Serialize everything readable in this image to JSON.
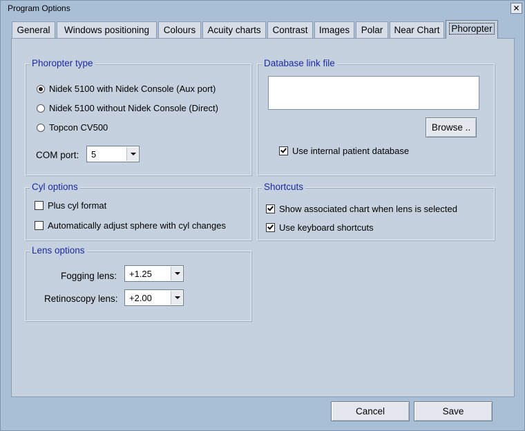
{
  "window": {
    "title": "Program Options",
    "close_glyph": "✕"
  },
  "tabs": [
    {
      "label": "General"
    },
    {
      "label": "Windows positioning"
    },
    {
      "label": "Colours"
    },
    {
      "label": "Acuity charts"
    },
    {
      "label": "Contrast"
    },
    {
      "label": "Images"
    },
    {
      "label": "Polar"
    },
    {
      "label": "Near Chart"
    },
    {
      "label": "Phoropter"
    }
  ],
  "active_tab": "Phoropter",
  "phoropter_type": {
    "title": "Phoropter type",
    "options": [
      {
        "label": "Nidek 5100 with Nidek Console  (Aux port)",
        "selected": true
      },
      {
        "label": "Nidek 5100 without  Nidek Console  (Direct)",
        "selected": false
      },
      {
        "label": "Topcon CV500",
        "selected": false
      }
    ],
    "com_port_label": "COM port:",
    "com_port_value": "5"
  },
  "database_link": {
    "title": "Database link file",
    "path_value": "",
    "browse_label": "Browse ..",
    "use_internal_label": "Use internal patient database",
    "use_internal_checked": true
  },
  "cyl_options": {
    "title": "Cyl options",
    "plus_cyl_label": "Plus cyl format",
    "plus_cyl_checked": false,
    "auto_adjust_label": "Automatically adjust sphere with cyl changes",
    "auto_adjust_checked": false
  },
  "shortcuts": {
    "title": "Shortcuts",
    "show_chart_label": "Show associated chart when lens is selected",
    "show_chart_checked": true,
    "keyboard_label": "Use keyboard shortcuts",
    "keyboard_checked": true
  },
  "lens_options": {
    "title": "Lens options",
    "fogging_label": "Fogging lens:",
    "fogging_value": "+1.25",
    "retinoscopy_label": "Retinoscopy lens:",
    "retinoscopy_value": "+2.00"
  },
  "footer": {
    "cancel_label": "Cancel",
    "save_label": "Save"
  }
}
